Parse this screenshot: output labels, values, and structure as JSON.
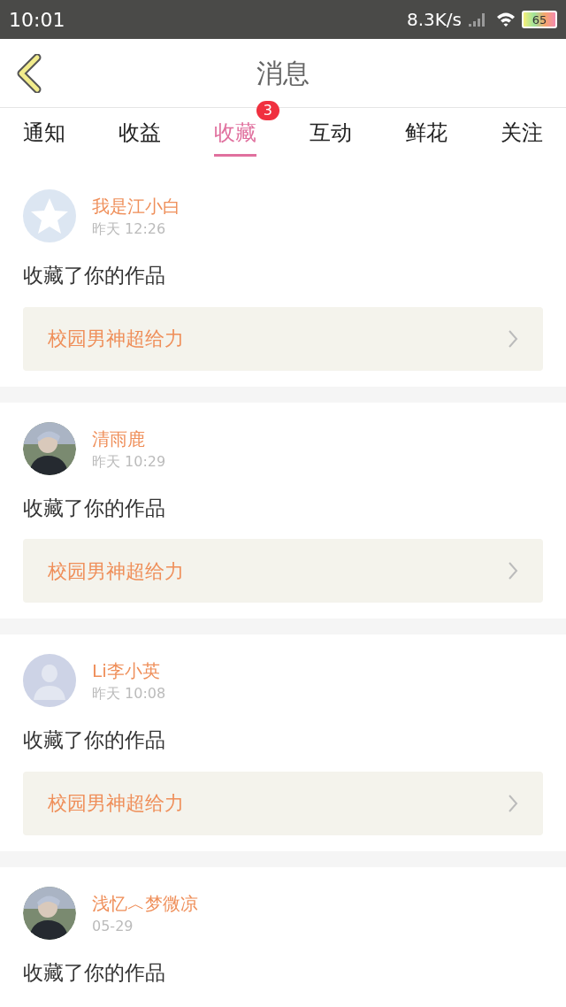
{
  "status_bar": {
    "time": "10:01",
    "speed": "8.3K/s",
    "battery": "65"
  },
  "header": {
    "title": "消息"
  },
  "tabs": [
    {
      "label": "通知",
      "selected": false
    },
    {
      "label": "收益",
      "selected": false
    },
    {
      "label": "收藏",
      "selected": true,
      "badge": "3"
    },
    {
      "label": "互动",
      "selected": false
    },
    {
      "label": "鲜花",
      "selected": false
    },
    {
      "label": "关注",
      "selected": false
    }
  ],
  "messages": [
    {
      "avatar": {
        "kind": "star-default"
      },
      "name": "我是江小白",
      "time": "昨天 12:26",
      "text": "收藏了你的作品",
      "work": "校园男神超给力"
    },
    {
      "name": "清雨鹿",
      "time": "昨天 10:29",
      "text": "收藏了你的作品",
      "work": "校园男神超给力"
    },
    {
      "avatar": {
        "kind": "person-default"
      },
      "name": "Li李小英",
      "time": "昨天 10:08",
      "text": "收藏了你的作品",
      "work": "校园男神超给力"
    },
    {
      "name": "浅忆︿梦微凉",
      "time": "05-29",
      "text": "收藏了你的作品"
    }
  ]
}
